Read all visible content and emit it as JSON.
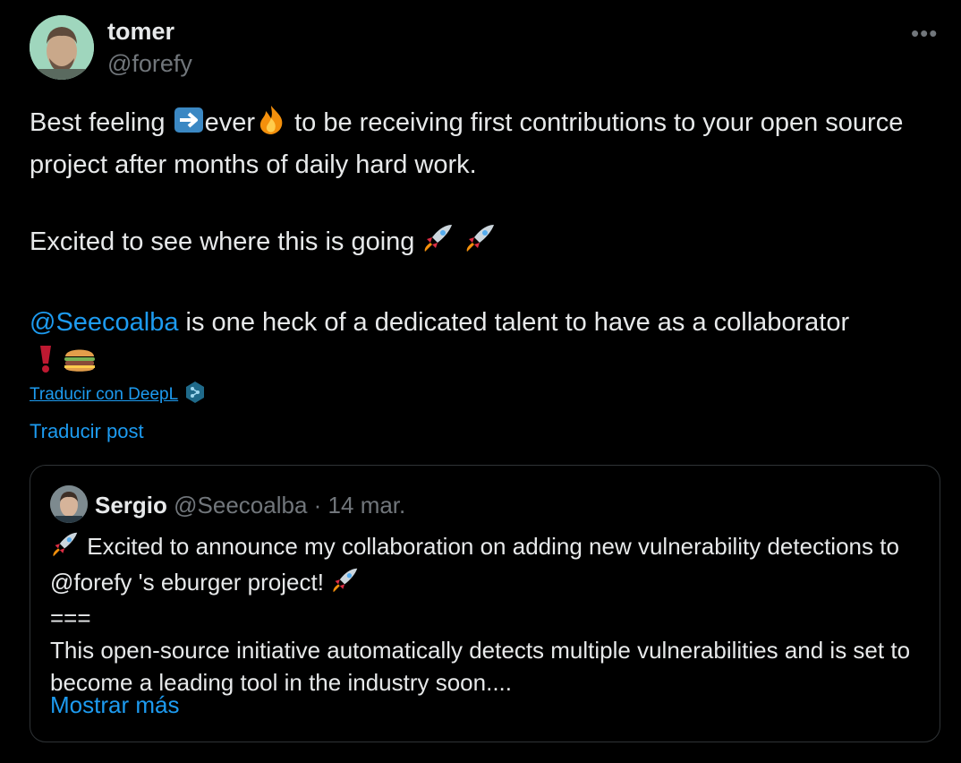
{
  "author": {
    "name": "tomer",
    "handle": "@forefy"
  },
  "more_icon": "more-options-icon",
  "tweet": {
    "line1_a": "Best feeling ",
    "line1_b": "ever",
    "line1_c": " to be receiving first contributions to your open source project after months of daily hard work.",
    "line2": "Excited to see where this is going ",
    "mention": "@Seecoalba",
    "line3": " is one heck of a dedicated talent to have as a collaborator"
  },
  "deepl_link": "Traducir con DeepL",
  "translate_link": "Traducir post",
  "quote": {
    "name": "Sergio",
    "handle": "@Seecoalba",
    "separator": " · ",
    "date": "14 mar.",
    "line1": " Excited to announce my collaboration on adding new vulnerability detections to @forefy 's eburger project! ",
    "line2": "===",
    "line3": "This open-source initiative automatically detects multiple vulnerabilities and is set to become a leading tool in the industry soon....",
    "show_more": "Mostrar más"
  },
  "colors": {
    "background": "#000000",
    "text": "#e7e9ea",
    "muted": "#71767b",
    "link": "#1d9bf0",
    "border": "#2f3336"
  }
}
